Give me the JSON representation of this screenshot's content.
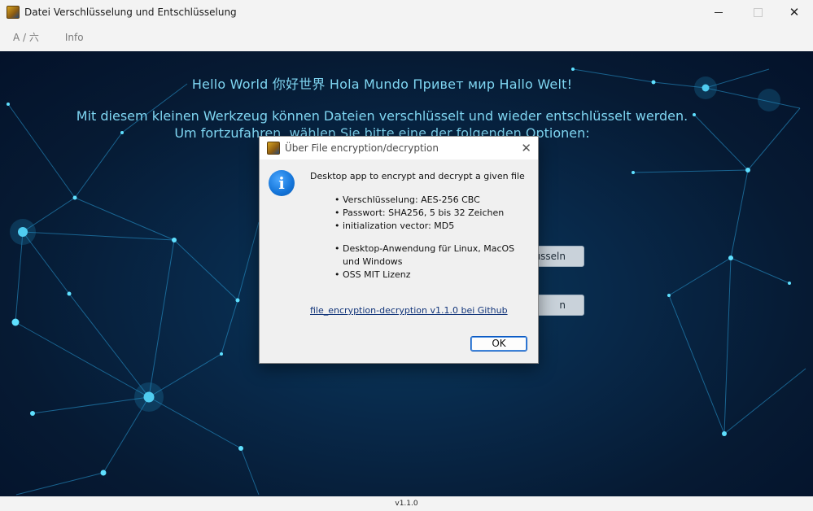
{
  "window": {
    "title": "Datei Verschlüsselung und Entschlüsselung",
    "icon": "app-lock-icon"
  },
  "menu": {
    "items": [
      {
        "label": "A / 六"
      },
      {
        "label": "Info"
      }
    ]
  },
  "main": {
    "hello": "Hello World 你好世界 Hola Mundo Привет мир Hallo Welt!",
    "intro_line1": "Mit diesem kleinen Werkzeug können Dateien verschlüsselt und wieder entschlüsselt werden.",
    "intro_line2": "Um fortzufahren, wählen Sie bitte eine der folgenden Optionen:",
    "button1_visible": "üsseln",
    "button2_visible": "n"
  },
  "status": {
    "version": "v1.1.0"
  },
  "dialog": {
    "title": "Über File encryption/decryption",
    "icon": "info-icon",
    "description": "Desktop app to encrypt and decrypt a given file",
    "features1": [
      "Verschlüsselung: AES-256 CBC",
      "Passwort: SHA256, 5 bis 32 Zeichen",
      "initialization vector: MD5"
    ],
    "features2": [
      "Desktop-Anwendung für Linux, MacOS und Windows",
      "OSS MIT Lizenz"
    ],
    "link": "file_encryption-decryption v1.1.0 bei Github",
    "ok_label": "OK"
  },
  "colors": {
    "background_dark": "#061a33",
    "accent_text": "#7fd6f2",
    "link": "#12357a",
    "ok_border": "#0b59c2"
  }
}
